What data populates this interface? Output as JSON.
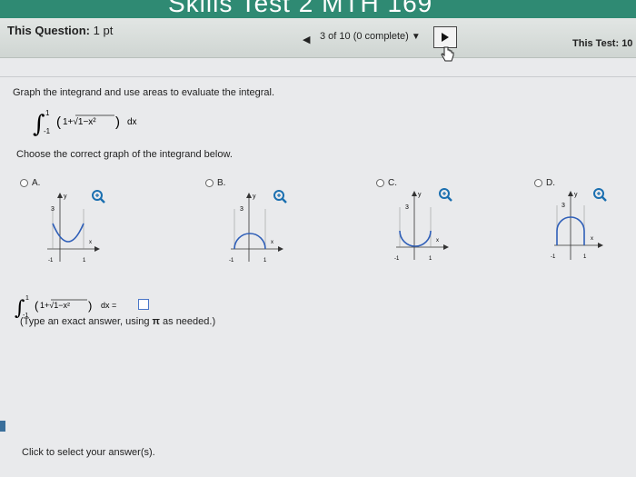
{
  "banner": {
    "title": "Skills Test 2 MTH 169"
  },
  "header": {
    "question_label": "This Question:",
    "question_points": "1 pt",
    "progress": "3 of 10 (0 complete)",
    "test_label": "This Test: 10"
  },
  "question": {
    "instruction": "Graph the integrand and use areas to evaluate the integral.",
    "integral_lower": "-1",
    "integral_upper": "1",
    "integrand": "1+√1−x²",
    "differential": "dx",
    "choose_prompt": "Choose the correct graph of the integrand below."
  },
  "options": [
    {
      "letter": "A."
    },
    {
      "letter": "B."
    },
    {
      "letter": "C."
    },
    {
      "letter": "D."
    }
  ],
  "graph_labels": {
    "y": "y",
    "x": "x",
    "y_tick": "3",
    "x_left": "-1",
    "x_right": "1"
  },
  "answer": {
    "equals": "dx =",
    "hint_prefix": "(Type an exact answer, using",
    "hint_symbol": "π",
    "hint_suffix": "as needed.)"
  },
  "footer": {
    "click_select": "Click to select your answer(s)."
  }
}
